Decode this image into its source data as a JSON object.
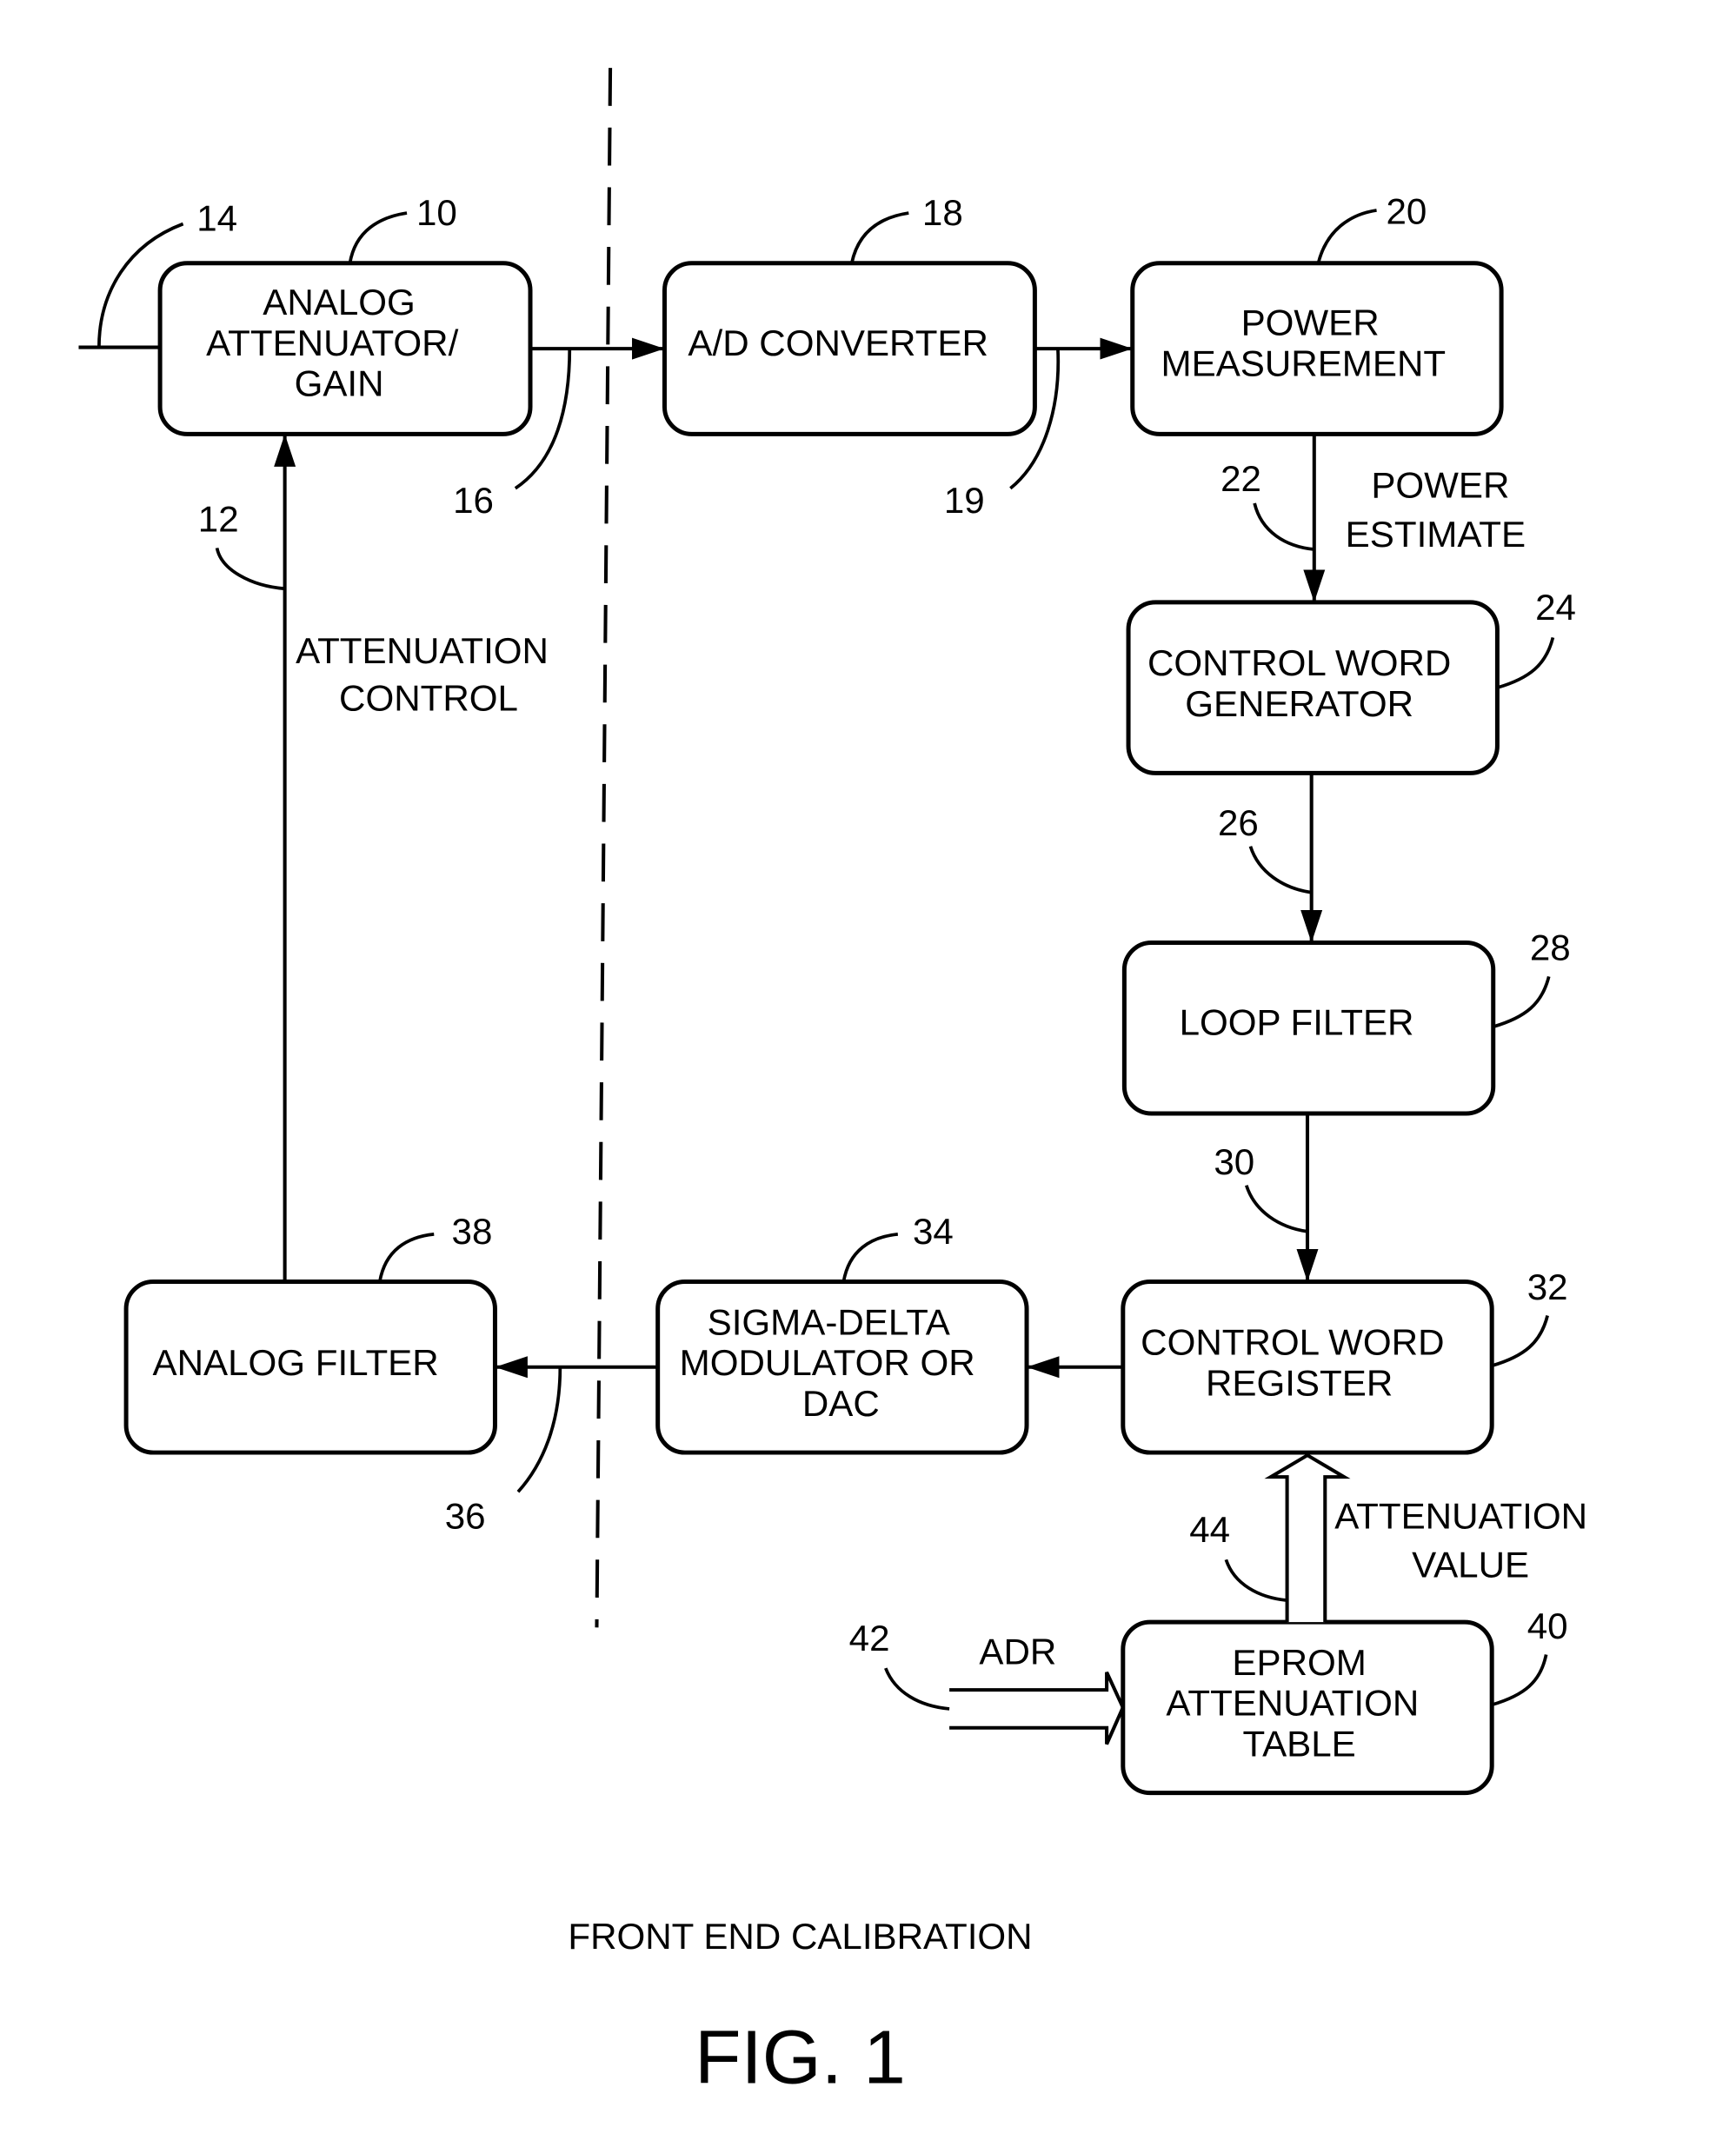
{
  "figure": {
    "caption": "FRONT END CALIBRATION",
    "number": "FIG. 1"
  },
  "blocks": {
    "analog_attenuator": {
      "ref": "10",
      "lines": [
        "ANALOG",
        "ATTENUATOR/",
        "GAIN"
      ]
    },
    "ad_converter": {
      "ref": "18",
      "lines": [
        "A/D CONVERTER"
      ]
    },
    "power_measurement": {
      "ref": "20",
      "lines": [
        "POWER",
        "MEASUREMENT"
      ]
    },
    "control_word_generator": {
      "ref": "24",
      "lines": [
        "CONTROL WORD",
        "GENERATOR"
      ]
    },
    "loop_filter": {
      "ref": "28",
      "lines": [
        "LOOP FILTER"
      ]
    },
    "control_word_register": {
      "ref": "32",
      "lines": [
        "CONTROL WORD",
        "REGISTER"
      ]
    },
    "sigma_delta": {
      "ref": "34",
      "lines": [
        "SIGMA-DELTA",
        "MODULATOR OR",
        "DAC"
      ]
    },
    "analog_filter": {
      "ref": "38",
      "lines": [
        "ANALOG FILTER"
      ]
    },
    "eprom_table": {
      "ref": "40",
      "lines": [
        "EPROM",
        "ATTENUATION",
        "TABLE"
      ]
    }
  },
  "signals": {
    "input": {
      "ref": "14"
    },
    "attenuator_out": {
      "ref": "16"
    },
    "adc_out": {
      "ref": "19"
    },
    "power_estimate": {
      "ref": "22",
      "lines": [
        "POWER",
        "ESTIMATE"
      ]
    },
    "control_word": {
      "ref": "26"
    },
    "filtered_word": {
      "ref": "30"
    },
    "filter_out": {
      "ref": "36"
    },
    "attenuation_control": {
      "ref": "12",
      "lines": [
        "ATTENUATION",
        "CONTROL"
      ]
    },
    "address": {
      "ref": "42",
      "label": "ADR"
    },
    "attenuation_value": {
      "ref": "44",
      "lines": [
        "ATTENUATION",
        "VALUE"
      ]
    }
  }
}
